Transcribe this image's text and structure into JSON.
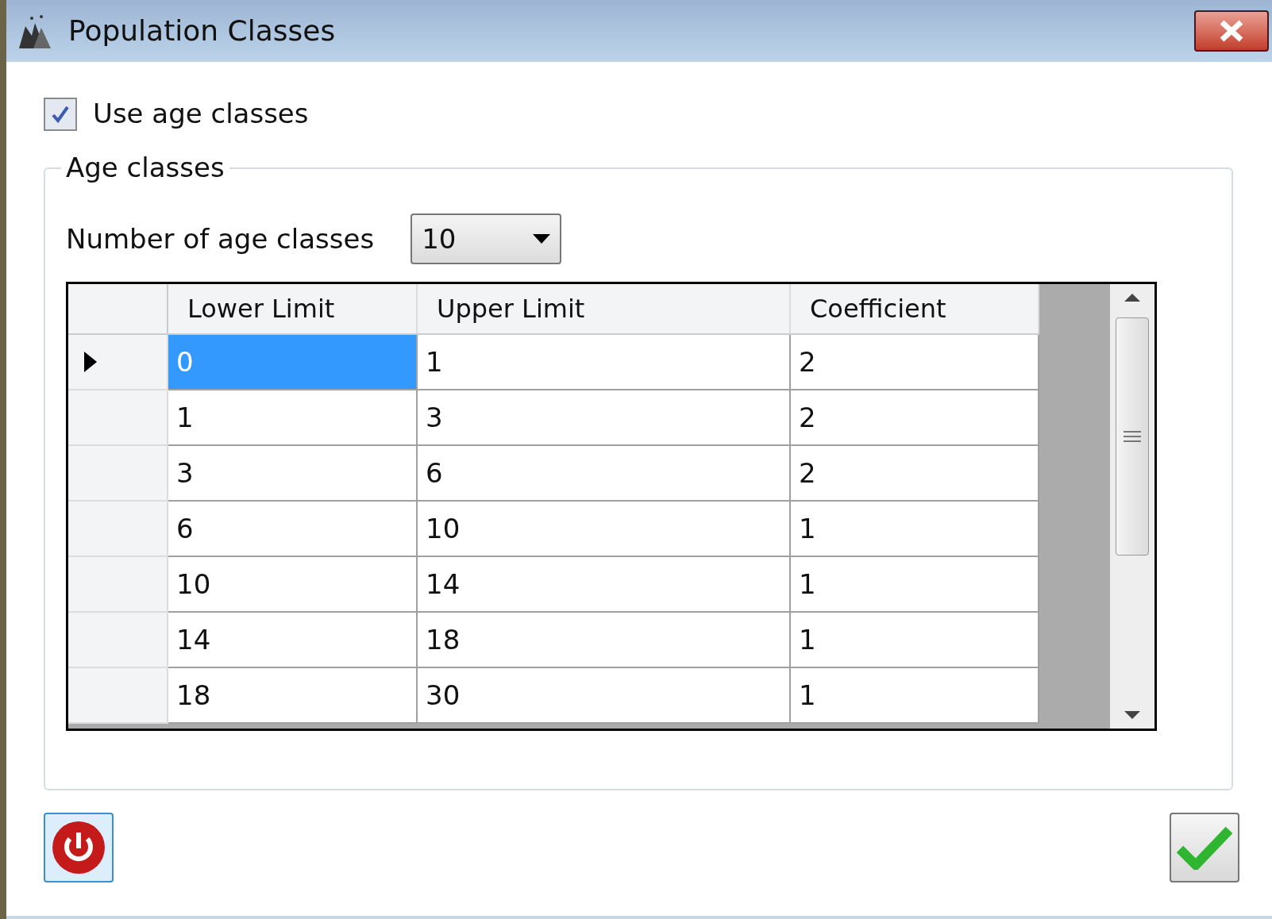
{
  "window": {
    "title": "Population Classes"
  },
  "use_age_classes": {
    "label": "Use age classes",
    "checked": true
  },
  "group": {
    "title": "Age classes",
    "count_label": "Number of age classes",
    "count_value": "10",
    "table": {
      "columns": [
        "Lower Limit",
        "Upper Limit",
        "Coefficient"
      ],
      "rows": [
        {
          "current": true,
          "cells": [
            {
              "text": "0",
              "selected": true
            },
            {
              "text": "1",
              "selected": false
            },
            {
              "text": "2",
              "selected": false
            }
          ]
        },
        {
          "current": false,
          "cells": [
            {
              "text": "1",
              "selected": false
            },
            {
              "text": "3",
              "selected": false
            },
            {
              "text": "2",
              "selected": false
            }
          ]
        },
        {
          "current": false,
          "cells": [
            {
              "text": "3",
              "selected": false
            },
            {
              "text": "6",
              "selected": false
            },
            {
              "text": "2",
              "selected": false
            }
          ]
        },
        {
          "current": false,
          "cells": [
            {
              "text": "6",
              "selected": false
            },
            {
              "text": "10",
              "selected": false
            },
            {
              "text": "1",
              "selected": false
            }
          ]
        },
        {
          "current": false,
          "cells": [
            {
              "text": "10",
              "selected": false
            },
            {
              "text": "14",
              "selected": false
            },
            {
              "text": "1",
              "selected": false
            }
          ]
        },
        {
          "current": false,
          "cells": [
            {
              "text": "14",
              "selected": false
            },
            {
              "text": "18",
              "selected": false
            },
            {
              "text": "1",
              "selected": false
            }
          ]
        },
        {
          "current": false,
          "cells": [
            {
              "text": "18",
              "selected": false
            },
            {
              "text": "30",
              "selected": false
            },
            {
              "text": "1",
              "selected": false
            }
          ]
        }
      ]
    }
  }
}
